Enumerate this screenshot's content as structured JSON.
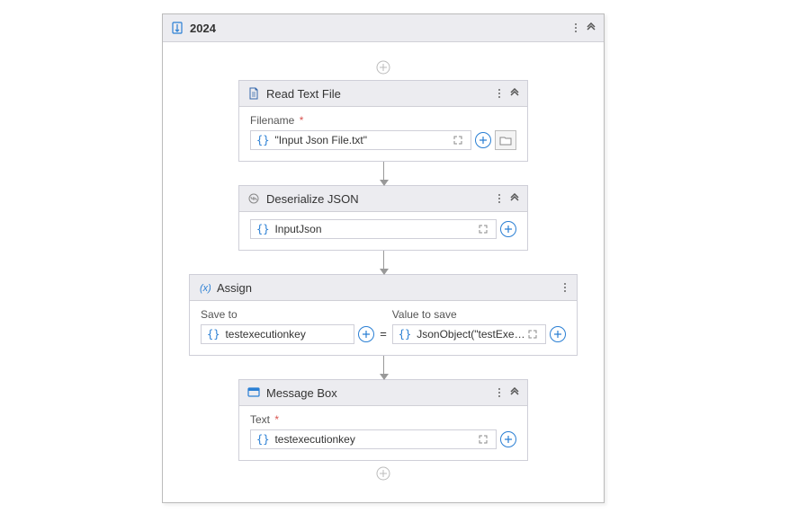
{
  "sequence": {
    "title": "2024"
  },
  "activities": {
    "readTextFile": {
      "title": "Read Text File",
      "fieldLabel": "Filename",
      "required": "*",
      "value": "\"Input Json File.txt\""
    },
    "deserializeJson": {
      "title": "Deserialize JSON",
      "value": "InputJson"
    },
    "assign": {
      "title": "Assign",
      "saveToLabel": "Save to",
      "valueLabel": "Value to save",
      "saveTo": "testexecutionkey",
      "equals": "=",
      "valueToSave": "JsonObject(\"testExecut"
    },
    "messageBox": {
      "title": "Message Box",
      "fieldLabel": "Text",
      "required": "*",
      "value": "testexecutionkey"
    }
  }
}
